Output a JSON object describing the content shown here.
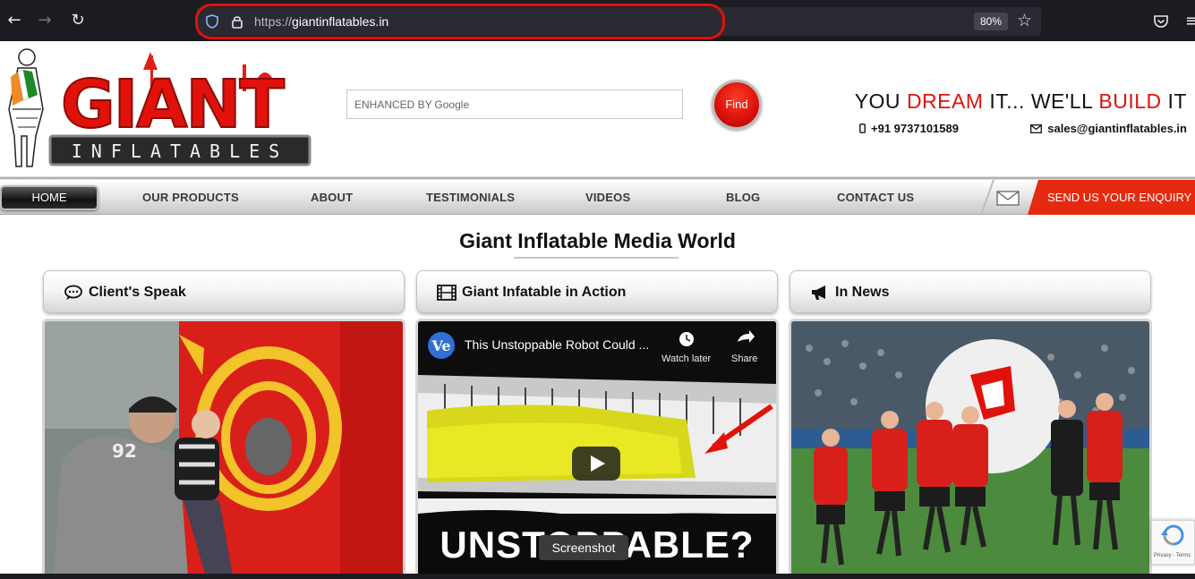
{
  "browser": {
    "url_prefix": "https://",
    "url_domain": "giantinflatables.in",
    "zoom": "80%"
  },
  "header": {
    "logo_top": "GIANT",
    "logo_bottom": "INFLATABLES",
    "search_hint": "ENHANCED BY",
    "search_brand": "Google",
    "find_label": "Find",
    "tagline_1": "YOU ",
    "tagline_2": "DREAM",
    "tagline_3": " IT... WE'LL ",
    "tagline_4": "BUILD",
    "tagline_5": " IT",
    "phone": "+91 9737101589",
    "email": "sales@giantinflatables.in"
  },
  "nav": {
    "items": [
      "HOME",
      "OUR PRODUCTS",
      "ABOUT",
      "TESTIMONIALS",
      "VIDEOS",
      "BLOG",
      "CONTACT US"
    ],
    "enquiry": "SEND US YOUR ENQUIRY"
  },
  "main": {
    "title": "Giant Inflatable Media World",
    "cards": [
      {
        "title": "Client's Speak",
        "icon": "comment-icon"
      },
      {
        "title": "Giant Infatable in Action",
        "icon": "film-icon"
      },
      {
        "title": "In News",
        "icon": "megaphone-icon"
      }
    ],
    "video": {
      "channel_badge": "Ve",
      "title": "This Unstoppable Robot Could ...",
      "watch_later": "Watch later",
      "share": "Share",
      "overlay": "UNSTOPPABLE?"
    }
  },
  "overlay": {
    "tooltip": "Screenshot",
    "recaptcha": "Privacy - Terms"
  },
  "colors": {
    "accent_red": "#e0120b",
    "browser_bg": "#1c1b22"
  }
}
